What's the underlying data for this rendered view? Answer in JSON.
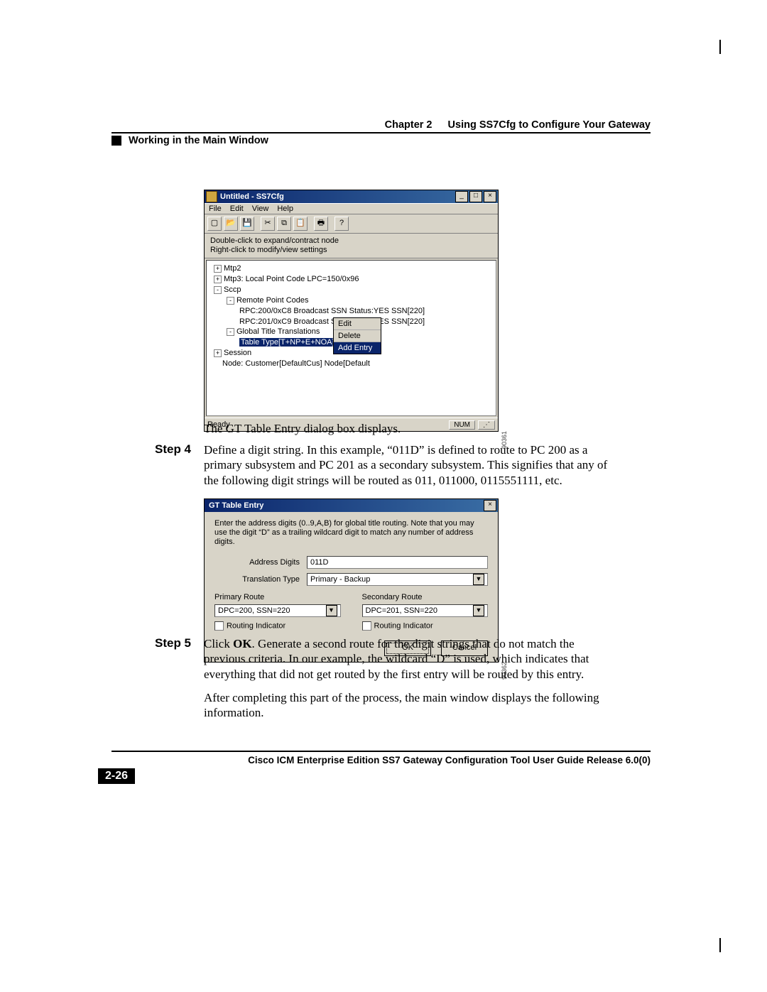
{
  "header": {
    "chapter_label": "Chapter 2",
    "chapter_title": "Using SS7Cfg to Configure Your Gateway",
    "section_title": "Working in the Main Window"
  },
  "app_window": {
    "title": "Untitled - SS7Cfg",
    "menus": [
      "File",
      "Edit",
      "View",
      "Help"
    ],
    "toolbar_icons": [
      "new",
      "open",
      "save",
      "cut",
      "copy",
      "paste",
      "print",
      "help"
    ],
    "instructions_line1": "Double-click to expand/contract node",
    "instructions_line2": "Right-click to modify/view settings",
    "tree": {
      "n0": "Mtp2",
      "n1": "Mtp3: Local Point Code LPC=150/0x96",
      "n2": "Sccp",
      "n3": "Remote Point Codes",
      "n4": "RPC:200/0xC8 Broadcast SSN Status:YES  SSN[220]",
      "n5": "RPC:201/0xC9 Broadcast SSN Status:YES  SSN[220]",
      "n6": "Global Title Translations",
      "n7_sel": "Table Type[T+NP+E+NOA] 2 1 1 1",
      "n8": "Session",
      "n9": "Node:  Customer[DefaultCus] Node[Default"
    },
    "context_menu": {
      "item1": "Edit",
      "item2": "Delete",
      "item3": "Add Entry"
    },
    "status_left": "Ready",
    "status_right": "NUM",
    "side_id": "90361"
  },
  "para_after_app": "The GT Table Entry dialog box displays.",
  "step4": {
    "label": "Step 4",
    "text": "Define a digit string. In this example, “011D” is defined to route to PC 200 as a primary subsystem and PC 201 as a secondary subsystem. This signifies that any of the following digit strings will be routed as 011, 011000, 0115551111, etc."
  },
  "dialog": {
    "title": "GT Table Entry",
    "hint": "Enter the address digits (0..9,A,B) for global title routing.  Note that you may use the digit “D” as a trailing wildcard digit to match any number of address digits.",
    "address_digits_label": "Address Digits",
    "address_digits_value": "011D",
    "translation_type_label": "Translation Type",
    "translation_type_value": "Primary - Backup",
    "primary_label": "Primary Route",
    "primary_value": "DPC=200, SSN=220",
    "secondary_label": "Secondary Route",
    "secondary_value": "DPC=201, SSN=220",
    "routing_indicator": "Routing Indicator",
    "ok": "OK",
    "cancel": "Cancel",
    "side_id": "90362"
  },
  "step5": {
    "label": "Step 5",
    "text_prefix": "Click ",
    "text_bold": "OK",
    "text_rest": ". Generate a second route for the digit strings that do not match the previous criteria. In our example, the wildcard “D” is used, which indicates that everything that did not get routed by the first entry will be routed by this entry."
  },
  "para_after_step5": "After completing this part of the process, the main window displays the following information.",
  "footer": {
    "doc_title": "Cisco ICM Enterprise Edition SS7 Gateway Configuration Tool User Guide Release 6.0(0)",
    "page_number": "2-26"
  }
}
